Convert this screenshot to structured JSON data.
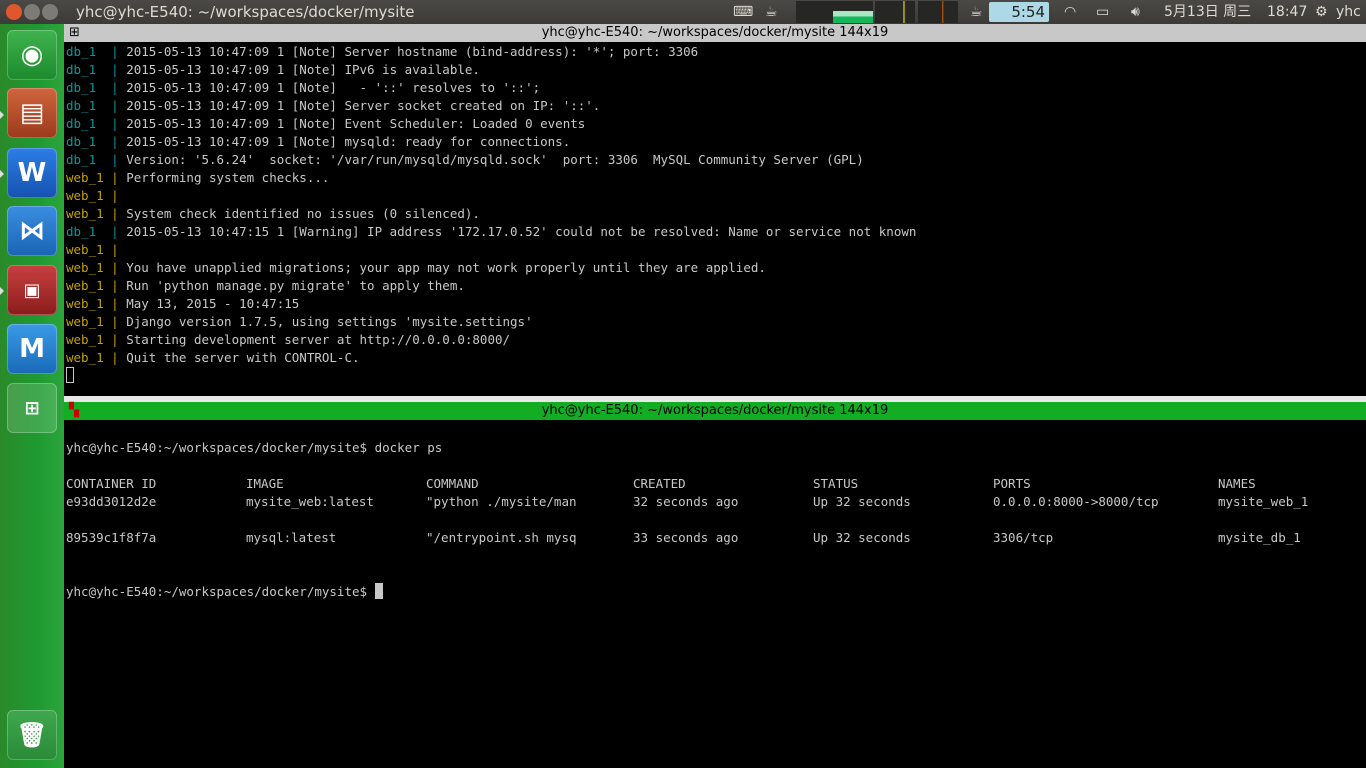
{
  "window": {
    "title": "yhc@yhc-E540: ~/workspaces/docker/mysite"
  },
  "panel": {
    "timer": "5:54",
    "date": "5月13日 周三",
    "time": "18:47",
    "user": "yhc",
    "icons": [
      "keyboard-icon",
      "cup-icon",
      "system-monitor-icon",
      "caffeine-icon",
      "wifi-icon",
      "battery-icon",
      "volume-icon",
      "gear-icon"
    ]
  },
  "launcher": {
    "items": [
      "ubuntu-dash",
      "files",
      "wps-writer",
      "visual-studio-code",
      "terminal",
      "maxthon",
      "workspace-switcher",
      "trash"
    ]
  },
  "top_pane": {
    "title": "yhc@yhc-E540: ~/workspaces/docker/mysite 144x19",
    "lines": [
      {
        "prefix": "db_1  ",
        "text": "2015-05-13 10:47:09 1 [Note] Server hostname (bind-address): '*'; port: 3306"
      },
      {
        "prefix": "db_1  ",
        "text": "2015-05-13 10:47:09 1 [Note] IPv6 is available."
      },
      {
        "prefix": "db_1  ",
        "text": "2015-05-13 10:47:09 1 [Note]   - '::' resolves to '::';"
      },
      {
        "prefix": "db_1  ",
        "text": "2015-05-13 10:47:09 1 [Note] Server socket created on IP: '::'."
      },
      {
        "prefix": "db_1  ",
        "text": "2015-05-13 10:47:09 1 [Note] Event Scheduler: Loaded 0 events"
      },
      {
        "prefix": "db_1  ",
        "text": "2015-05-13 10:47:09 1 [Note] mysqld: ready for connections."
      },
      {
        "prefix": "db_1  ",
        "text": "Version: '5.6.24'  socket: '/var/run/mysqld/mysqld.sock'  port: 3306  MySQL Community Server (GPL)"
      },
      {
        "prefix": "web_1 ",
        "text": "Performing system checks..."
      },
      {
        "prefix": "web_1 ",
        "text": ""
      },
      {
        "prefix": "web_1 ",
        "text": "System check identified no issues (0 silenced)."
      },
      {
        "prefix": "db_1  ",
        "text": "2015-05-13 10:47:15 1 [Warning] IP address '172.17.0.52' could not be resolved: Name or service not known"
      },
      {
        "prefix": "web_1 ",
        "text": ""
      },
      {
        "prefix": "web_1 ",
        "text": "You have unapplied migrations; your app may not work properly until they are applied."
      },
      {
        "prefix": "web_1 ",
        "text": "Run 'python manage.py migrate' to apply them."
      },
      {
        "prefix": "web_1 ",
        "text": "May 13, 2015 - 10:47:15"
      },
      {
        "prefix": "web_1 ",
        "text": "Django version 1.7.5, using settings 'mysite.settings'"
      },
      {
        "prefix": "web_1 ",
        "text": "Starting development server at http://0.0.0.0:8000/"
      },
      {
        "prefix": "web_1 ",
        "text": "Quit the server with CONTROL-C."
      }
    ]
  },
  "bottom_pane": {
    "title": "yhc@yhc-E540: ~/workspaces/docker/mysite 144x19",
    "prompt": "yhc@yhc-E540:~/workspaces/docker/mysite$ ",
    "command": "docker ps",
    "headers": [
      "CONTAINER ID",
      "IMAGE",
      "COMMAND",
      "CREATED",
      "STATUS",
      "PORTS",
      "NAMES"
    ],
    "rows": [
      [
        "e93dd3012d2e",
        "mysite_web:latest",
        "\"python ./mysite/man",
        "32 seconds ago",
        "Up 32 seconds",
        "0.0.0.0:8000->8000/tcp",
        "mysite_web_1"
      ],
      [
        "89539c1f8f7a",
        "mysql:latest",
        "\"/entrypoint.sh mysq",
        "33 seconds ago",
        "Up 32 seconds",
        "3306/tcp",
        "mysite_db_1"
      ]
    ]
  }
}
